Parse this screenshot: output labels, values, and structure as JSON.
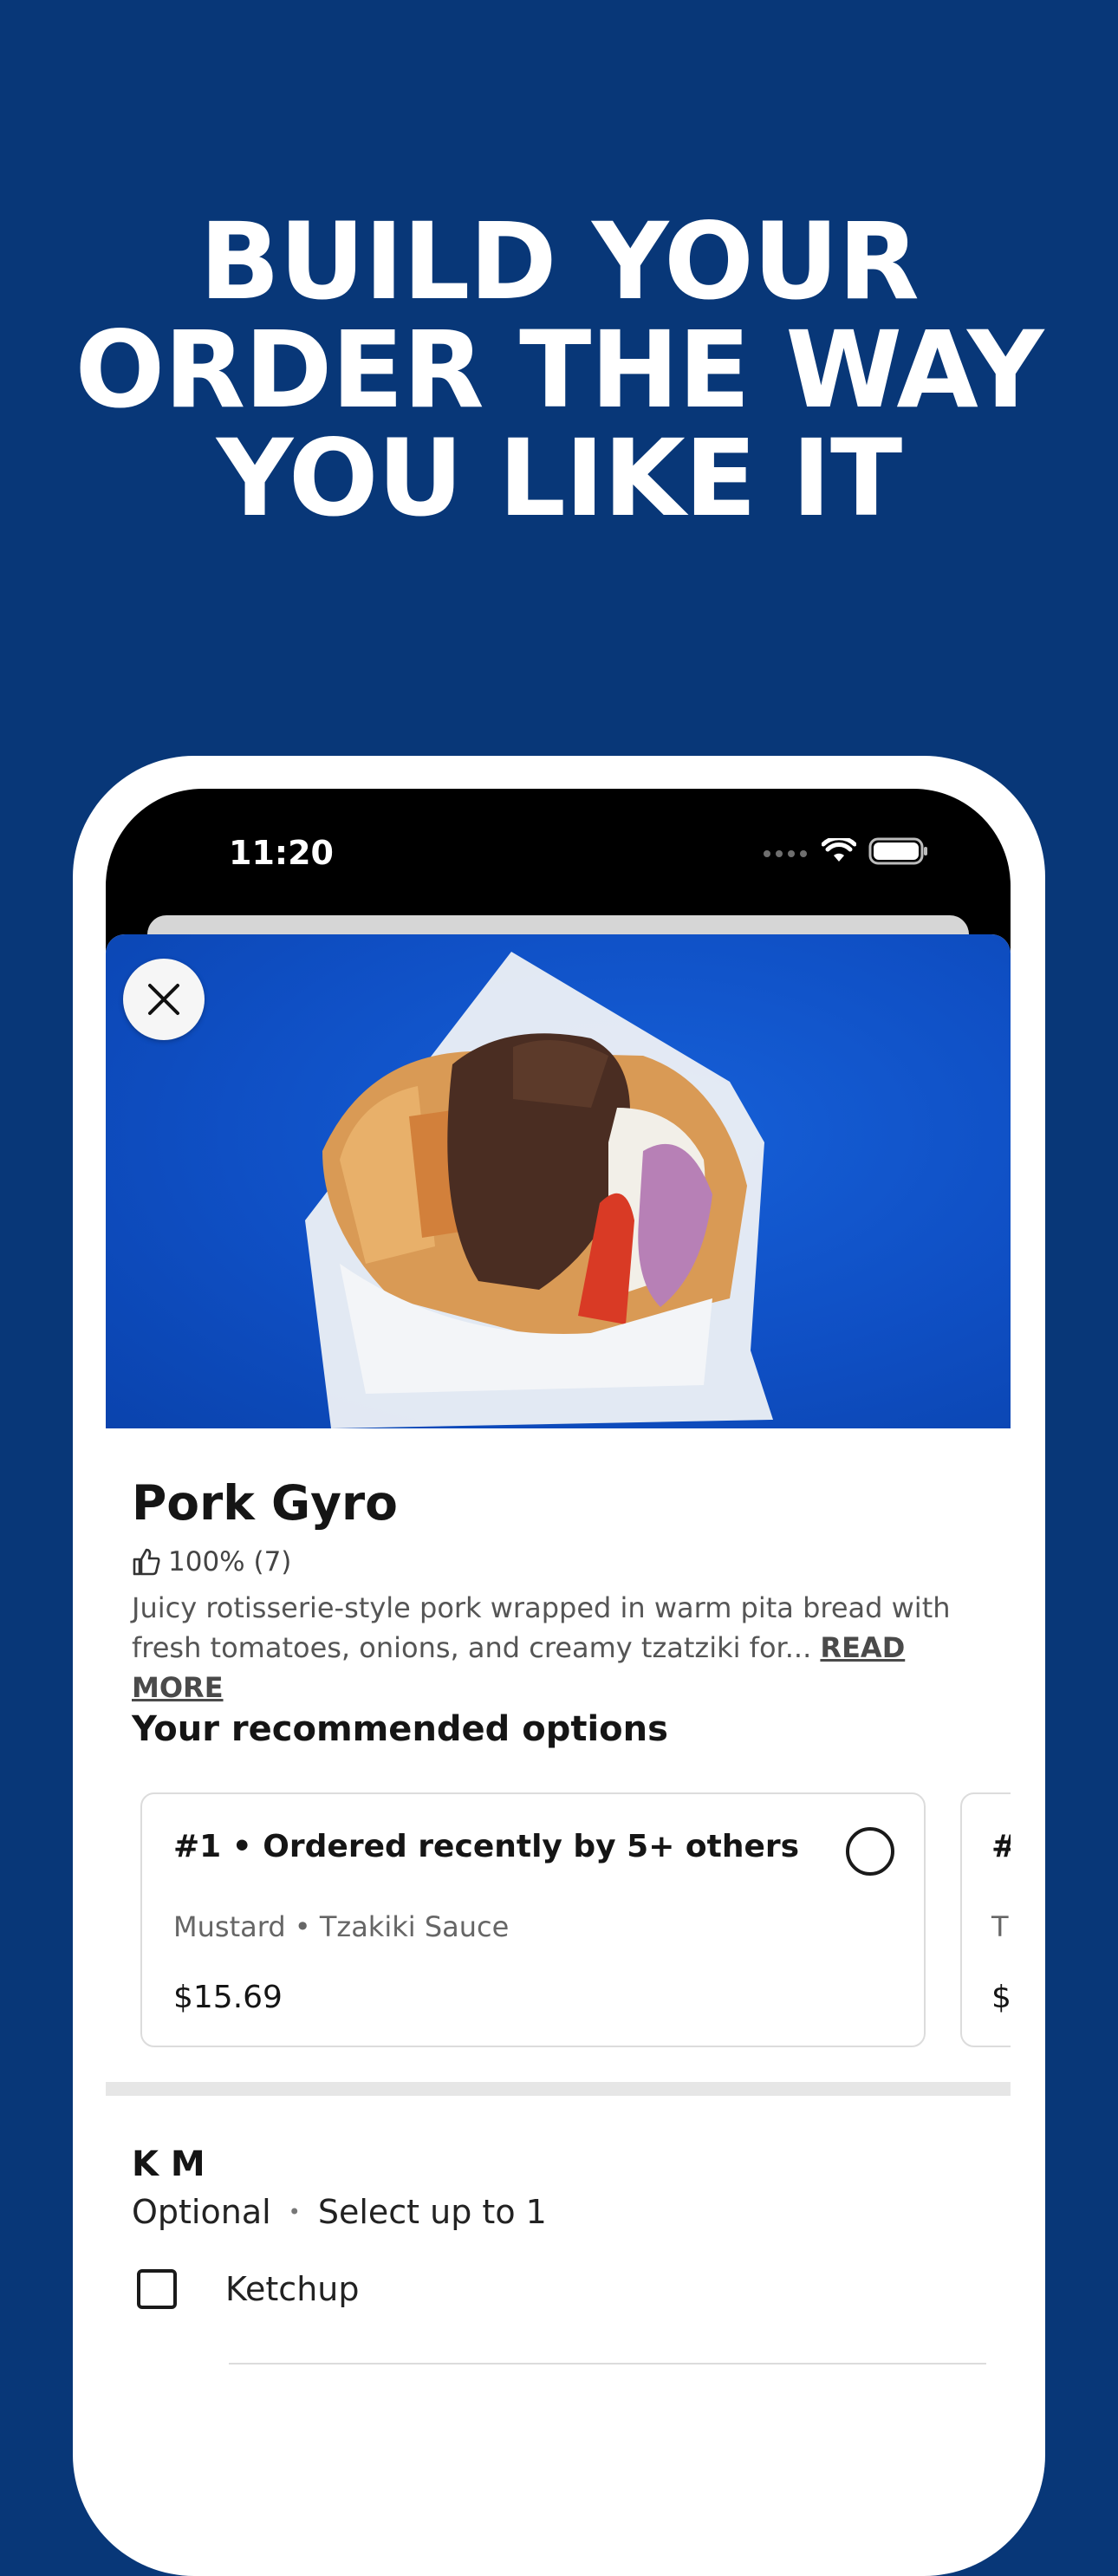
{
  "headline": {
    "lines": [
      "BUILD YOUR",
      "ORDER THE WAY",
      "YOU LIKE IT"
    ]
  },
  "status_bar": {
    "time": "11:20",
    "icons": [
      "signal-dots-icon",
      "wifi-icon",
      "battery-icon"
    ]
  },
  "item": {
    "name": "Pork Gyro",
    "rating": "100% (7)",
    "description": "Juicy rotisserie-style pork wrapped in warm pita bread with fresh tomatoes, onions, and creamy tzatziki for...",
    "read_more": "READ MORE"
  },
  "recommended": {
    "heading": "Your recommended options",
    "cards": [
      {
        "title": "#1 • Ordered recently by 5+ others",
        "subtitle": "Mustard • Tzakiki Sauce",
        "price": "$15.69"
      },
      {
        "title": "#",
        "subtitle": "T",
        "price": "$"
      }
    ]
  },
  "option_group": {
    "title": "K M",
    "optional": "Optional",
    "dot": "•",
    "limit": "Select up to 1",
    "options": [
      {
        "label": "Ketchup"
      }
    ]
  },
  "colors": {
    "background": "#083778",
    "hero_blue": "#1258d0"
  }
}
